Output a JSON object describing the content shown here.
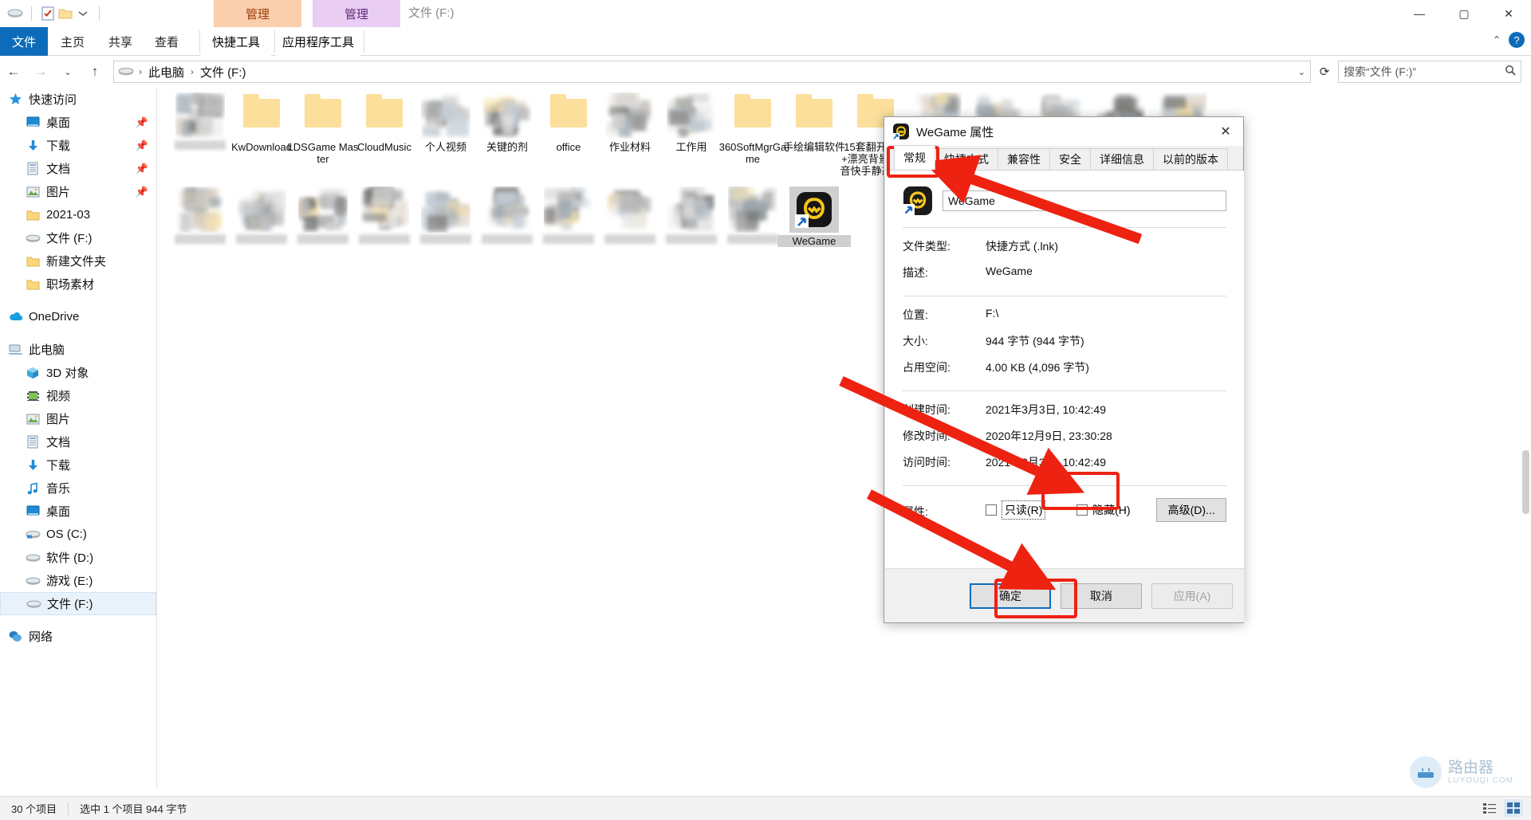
{
  "window": {
    "caption": "文件 (F:)",
    "quick_access_icons": [
      "drive-icon",
      "properties-checklist-icon",
      "new-folder-icon",
      "customize-chevron-icon"
    ],
    "contextual_tabs": [
      {
        "label": "管理",
        "accent": "#f9cfae",
        "text_color": "#9a3a06"
      },
      {
        "label": "管理",
        "accent": "#e9cdf3",
        "text_color": "#5b2b79"
      }
    ],
    "buttons": {
      "minimize": "—",
      "maximize": "▢",
      "close": "✕"
    }
  },
  "ribbon": {
    "tabs": [
      {
        "label": "文件",
        "active": true
      },
      {
        "label": "主页",
        "active": false
      },
      {
        "label": "共享",
        "active": false
      },
      {
        "label": "查看",
        "active": false
      },
      {
        "label": "快捷工具",
        "active": false
      },
      {
        "label": "应用程序工具",
        "active": false
      }
    ],
    "collapse_icon": "chevron-up-icon",
    "help_icon": "help-icon"
  },
  "address_bar": {
    "back_icon": "back-arrow-icon",
    "forward_icon": "forward-arrow-icon",
    "recent_icon": "chevron-down-icon",
    "up_icon": "up-arrow-icon",
    "drive_icon": "drive-icon",
    "crumbs": [
      "此电脑",
      "文件 (F:)"
    ],
    "dropdown_icon": "chevron-down-icon",
    "refresh_icon": "refresh-icon",
    "search_placeholder": "搜索“文件 (F:)”",
    "search_value": "",
    "search_icon": "search-icon"
  },
  "nav_pane": {
    "groups": [
      {
        "header": {
          "label": "快速访问",
          "icon": "star-icon"
        },
        "items": [
          {
            "label": "桌面",
            "icon": "desktop-icon",
            "pinned": true
          },
          {
            "label": "下载",
            "icon": "download-icon",
            "pinned": true
          },
          {
            "label": "文档",
            "icon": "documents-icon",
            "pinned": true
          },
          {
            "label": "图片",
            "icon": "pictures-icon",
            "pinned": true
          },
          {
            "label": "2021-03",
            "icon": "folder-icon",
            "pinned": false
          },
          {
            "label": "文件 (F:)",
            "icon": "drive-icon",
            "pinned": false
          },
          {
            "label": "新建文件夹",
            "icon": "folder-icon",
            "pinned": false
          },
          {
            "label": "职场素材",
            "icon": "folder-icon",
            "pinned": false
          }
        ]
      },
      {
        "header": {
          "label": "OneDrive",
          "icon": "onedrive-icon"
        },
        "items": []
      },
      {
        "header": {
          "label": "此电脑",
          "icon": "this-pc-icon"
        },
        "items": [
          {
            "label": "3D 对象",
            "icon": "3d-objects-icon",
            "pinned": false
          },
          {
            "label": "视频",
            "icon": "videos-icon",
            "pinned": false
          },
          {
            "label": "图片",
            "icon": "pictures-icon",
            "pinned": false
          },
          {
            "label": "文档",
            "icon": "documents-icon",
            "pinned": false
          },
          {
            "label": "下载",
            "icon": "download-icon",
            "pinned": false
          },
          {
            "label": "音乐",
            "icon": "music-icon",
            "pinned": false
          },
          {
            "label": "桌面",
            "icon": "desktop-icon",
            "pinned": false
          },
          {
            "label": "OS (C:)",
            "icon": "os-drive-icon",
            "pinned": false
          },
          {
            "label": "软件 (D:)",
            "icon": "drive-icon",
            "pinned": false
          },
          {
            "label": "游戏 (E:)",
            "icon": "drive-icon",
            "pinned": false
          },
          {
            "label": "文件 (F:)",
            "icon": "drive-icon",
            "pinned": false,
            "selected": true
          }
        ]
      },
      {
        "header": {
          "label": "网络",
          "icon": "network-icon"
        },
        "items": []
      }
    ]
  },
  "files": {
    "row1": [
      {
        "label": "",
        "blurred": true
      },
      {
        "label": "KwDownload",
        "blurred": false
      },
      {
        "label": "LDSGame Master",
        "blurred": false
      },
      {
        "label": "CloudMusic",
        "blurred": false
      },
      {
        "label": "个人视频",
        "blurred": true
      },
      {
        "label": "关键的剂",
        "blurred": true
      },
      {
        "label": "office",
        "blurred": false
      },
      {
        "label": "作业材料",
        "blurred": true
      },
      {
        "label": "工作用",
        "blurred": true
      },
      {
        "label": "360SoftMgrGame",
        "blurred": false
      },
      {
        "label": "手绘编辑软件",
        "blurred": false
      },
      {
        "label": "15套翻开的书+漂亮背景的抖音快手静态书...",
        "blurred": false
      },
      {
        "label": "",
        "blurred": true
      },
      {
        "label": "",
        "blurred": true
      },
      {
        "label": "",
        "blurred": true
      },
      {
        "label": "",
        "blurred": true
      },
      {
        "label": "",
        "blurred": true
      }
    ],
    "row2": [
      {
        "label": "",
        "blurred": true
      },
      {
        "label": "",
        "blurred": true
      },
      {
        "label": "",
        "blurred": true
      },
      {
        "label": "",
        "blurred": true
      },
      {
        "label": "",
        "blurred": true
      },
      {
        "label": "",
        "blurred": true
      },
      {
        "label": "",
        "blurred": true
      },
      {
        "label": "",
        "blurred": true
      },
      {
        "label": "",
        "blurred": true
      },
      {
        "label": "",
        "blurred": true
      },
      {
        "label": "WeGame",
        "blurred": false,
        "selected": true
      }
    ]
  },
  "status_bar": {
    "item_count": "30 个项目",
    "selection": "选中 1 个项目  944 字节",
    "view_icons": [
      "details-view-icon",
      "large-icons-view-icon"
    ]
  },
  "dialog": {
    "title": "WeGame 属性",
    "icon": "wegame-shortcut-icon",
    "close_icon": "close-icon",
    "tabs": [
      {
        "label": "常规",
        "active": true
      },
      {
        "label": "快捷方式",
        "active": false
      },
      {
        "label": "兼容性",
        "active": false
      },
      {
        "label": "安全",
        "active": false
      },
      {
        "label": "详细信息",
        "active": false
      },
      {
        "label": "以前的版本",
        "active": false
      }
    ],
    "name_value": "WeGame",
    "rows": [
      {
        "label": "文件类型:",
        "value": "快捷方式 (.lnk)"
      },
      {
        "label": "描述:",
        "value": "WeGame"
      },
      {
        "label": "位置:",
        "value": "F:\\"
      },
      {
        "label": "大小:",
        "value": "944 字节 (944 字节)"
      },
      {
        "label": "占用空间:",
        "value": "4.00 KB (4,096 字节)"
      },
      {
        "label": "创建时间:",
        "value": "2021年3月3日, 10:42:49"
      },
      {
        "label": "修改时间:",
        "value": "2020年12月9日, 23:30:28"
      },
      {
        "label": "访问时间:",
        "value": "2021年3月3日, 10:42:49"
      }
    ],
    "attributes": {
      "label": "属性:",
      "readonly": {
        "label": "只读(R)",
        "checked": false
      },
      "hidden": {
        "label": "隐藏(H)",
        "checked": false
      },
      "advanced": {
        "label": "高级(D)..."
      }
    },
    "footer": {
      "ok": "确定",
      "cancel": "取消",
      "apply": "应用(A)",
      "apply_disabled": true
    }
  },
  "annotations": {
    "highlight_color": "#ee2211",
    "boxes": [
      {
        "name": "tab-general-highlight"
      },
      {
        "name": "hidden-checkbox-highlight"
      },
      {
        "name": "ok-button-highlight"
      }
    ],
    "arrows": [
      {
        "name": "arrow-to-general-tab"
      },
      {
        "name": "arrow-to-hidden-checkbox"
      },
      {
        "name": "arrow-to-ok-button"
      }
    ]
  },
  "watermark": {
    "icon": "router-icon",
    "title": "路由器",
    "subtitle": "LUYOUQI.COM"
  }
}
